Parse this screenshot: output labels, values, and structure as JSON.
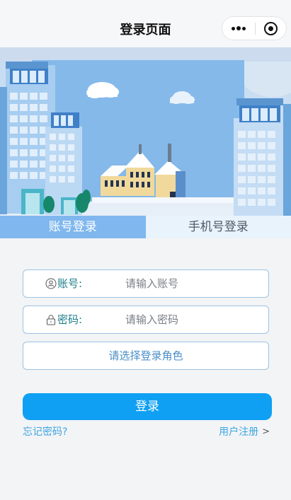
{
  "navbar": {
    "title": "登录页面",
    "more_icon": "more-dots-icon",
    "close_icon": "target-circle-icon"
  },
  "banner": {
    "description_icon": "city-buildings-illustration"
  },
  "tabs": [
    {
      "label": "账号登录",
      "active": true
    },
    {
      "label": "手机号登录",
      "active": false
    }
  ],
  "form": {
    "account": {
      "label": "账号:",
      "placeholder": "请输入账号",
      "value": "",
      "icon": "user-icon"
    },
    "password": {
      "label": "密码:",
      "placeholder": "请输入密码",
      "value": "",
      "icon": "lock-icon"
    },
    "role": {
      "placeholder": "请选择登录角色"
    },
    "login_label": "登录",
    "forgot_label": "忘记密码?",
    "register_label": "用户注册"
  },
  "colors": {
    "primary": "#0fa0f4",
    "tab_active": "#7fb7ee",
    "tab_inactive": "#e9f3fc",
    "label": "#1c7e8a"
  }
}
